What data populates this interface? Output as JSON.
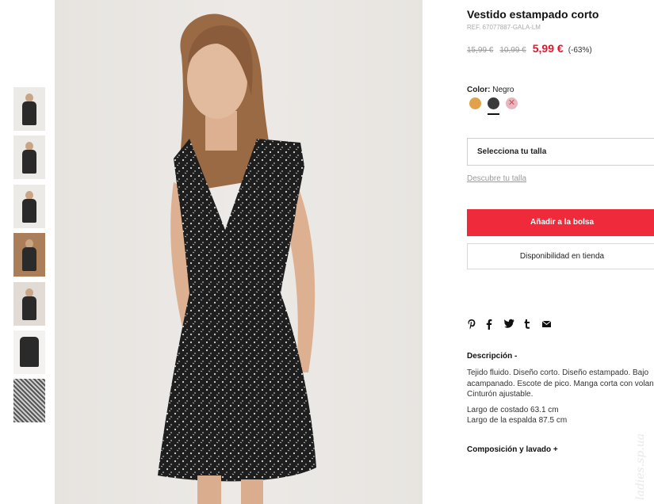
{
  "product": {
    "title": "Vestido estampado corto",
    "ref": "REF. 67077887-GALA-LM",
    "prices": {
      "original": "15,99 €",
      "previous": "10,99 €",
      "current": "5,99 €",
      "discount": "(-63%)"
    },
    "color": {
      "label": "Color:",
      "selected": "Negro",
      "swatches": [
        {
          "color": "#e1a24b",
          "available": true
        },
        {
          "color": "#3a3a3a",
          "available": true,
          "selected": true
        },
        {
          "color": "#e8b6bd",
          "available": false
        }
      ]
    },
    "size_select": "Selecciona tu talla",
    "size_link": "Descubre tu talla",
    "add_to_bag": "Añadir a la bolsa",
    "store_availability": "Disponibilidad en tienda",
    "share_icons": [
      "pinterest-icon",
      "facebook-icon",
      "twitter-icon",
      "tumblr-icon",
      "mail-icon"
    ],
    "description": {
      "heading": "Descripción -",
      "text": "Tejido fluido. Diseño corto. Diseño estampado. Bajo\nacampanado. Escote de pico. Manga corta con volante.\nCinturón ajustable.",
      "measurements": [
        "Largo de costado 63.1 cm",
        "Largo de la espalda 87.5 cm"
      ]
    },
    "composition_heading": "Composición y lavado +"
  },
  "gallery": {
    "thumbnails": [
      "front",
      "full-front",
      "full-back",
      "seated",
      "closeup",
      "flat",
      "fabric"
    ]
  },
  "watermark": "ladies.sp.ua",
  "colors": {
    "accent_red": "#ef2a3a",
    "price_red": "#e4142d"
  }
}
